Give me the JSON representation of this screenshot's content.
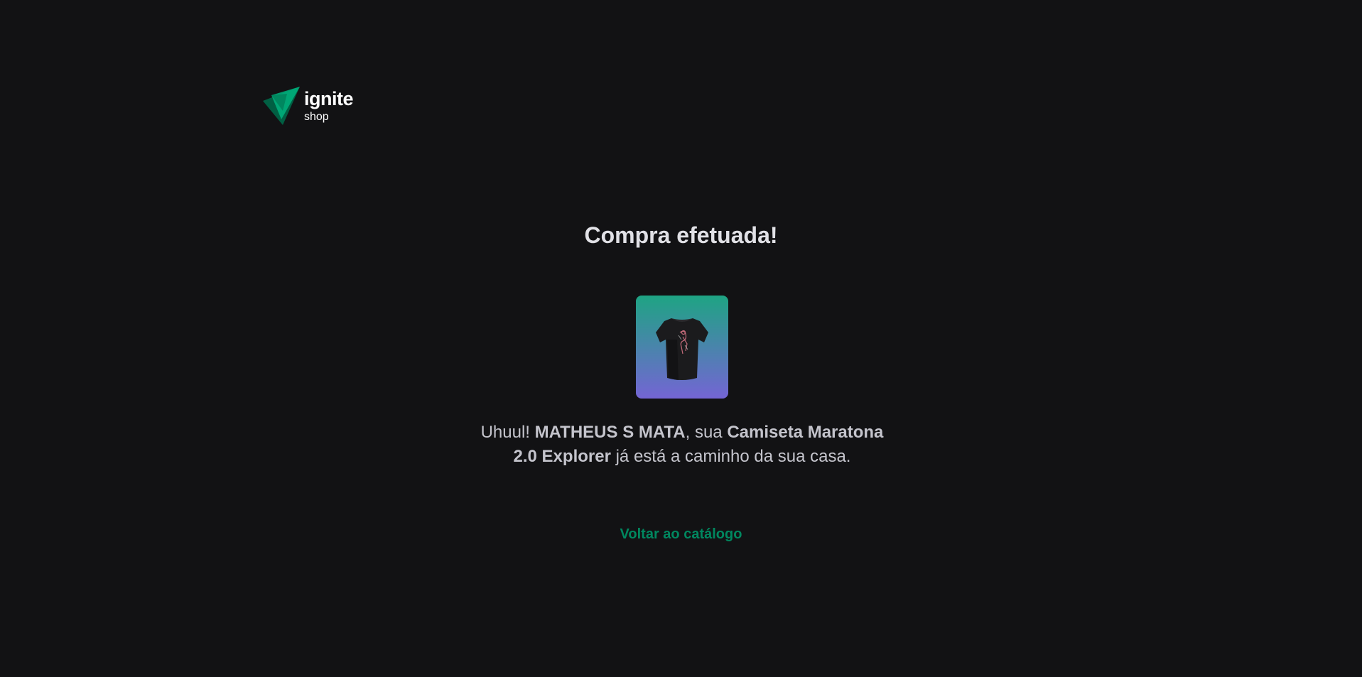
{
  "header": {
    "logo_title": "ignite",
    "logo_subtitle": "shop"
  },
  "main": {
    "title": "Compra efetuada!",
    "message": {
      "greeting": "Uhuul!",
      "customer_name": "MATHEUS S MATA",
      "middle": ", sua",
      "product_name": "Camiseta Maratona 2.0 Explorer",
      "ending": "já está a caminho da sua casa."
    },
    "product_image_icon": "t-shirt-image",
    "back_link_label": "Voltar ao catálogo"
  },
  "colors": {
    "background": "#121214",
    "title": "#e1e1e6",
    "text": "#c4c4cc",
    "link": "#00875f",
    "gradient_start": "#1ea483",
    "gradient_end": "#7465d4",
    "logo_green_light": "#00b37e",
    "logo_green_dark": "#015f43"
  }
}
